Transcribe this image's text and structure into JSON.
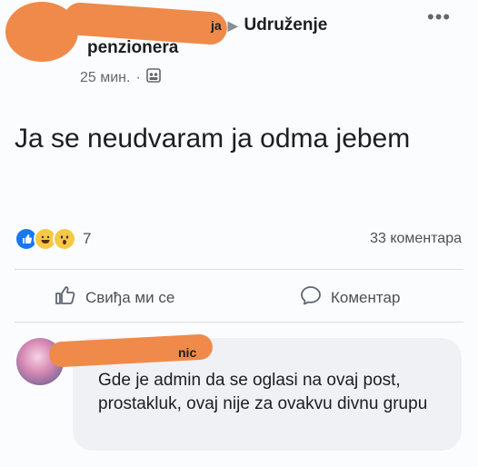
{
  "post": {
    "author_fragment": "ja",
    "group_name_line1": "Udruženje",
    "group_name_line2": "penzionera",
    "time": "25 мин.",
    "separator": "·",
    "text": "Ja se neudvaram ja odma jebem",
    "more_label": "•••"
  },
  "stats": {
    "reaction_count": "7",
    "comment_count": "33 коментара"
  },
  "actions": {
    "like_label": "Свиђа ми се",
    "comment_label": "Коментар"
  },
  "comment": {
    "author_fragment": "nic",
    "text": "Gde je admin da se oglasi na ovaj post, prostakluk, ovaj nije za ovakvu divnu grupu"
  },
  "colors": {
    "accent": "#1877f2",
    "redaction": "#ef8a4a",
    "reaction_yellow": "#f7c844"
  },
  "icons": {
    "reactions": [
      "like-reaction-icon",
      "haha-reaction-icon",
      "wow-reaction-icon"
    ],
    "like": "thumbs-up-icon",
    "comment": "speech-bubble-icon",
    "privacy": "group-members-icon"
  }
}
